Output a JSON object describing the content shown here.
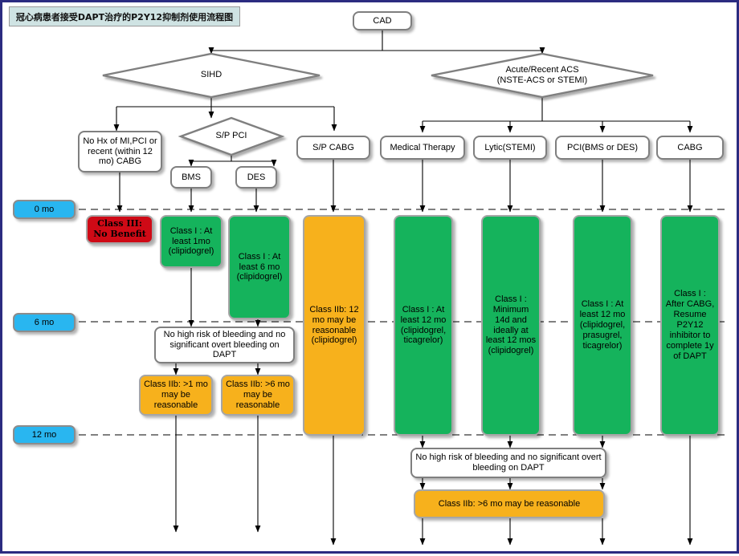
{
  "chart_title": "冠心病患者接受DAPT治疗的P2Y12抑制剂使用流程图",
  "colors": {
    "class1_green": "#15b35c",
    "class2b_orange": "#f7b11c",
    "class3_red": "#cf0a16",
    "timeline_blue": "#29b6f0",
    "title_bg": "#cfe3e3",
    "border_navy": "#2b2b80",
    "node_gray": "#7f7f7f"
  },
  "root": {
    "label": "CAD"
  },
  "decisions": {
    "sihd": "SIHD",
    "acs_line1": "Acute/Recent  ACS",
    "acs_line2": "(NSTE-ACS or STEMI)",
    "spci": "S/P PCI"
  },
  "timeline": [
    {
      "label": "0 mo"
    },
    {
      "label": "6 mo"
    },
    {
      "label": "12 mo"
    }
  ],
  "branches": {
    "no_hx": "No Hx of MI,PCI or recent (within 12 mo) CABG",
    "bms": "BMS",
    "des": "DES",
    "sp_cabg": "S/P CABG",
    "medical_therapy": "Medical Therapy",
    "lytic": "Lytic(STEMI)",
    "pci": "PCI(BMS or DES)",
    "cabg": "CABG"
  },
  "recommendations": {
    "no_hx_rec": "Class III: No Benefit",
    "bms_rec": "Class I : At least 1mo (clipidogrel)",
    "des_rec": "Class I : At least 6 mo (clipidogrel)",
    "cabg_sihd_rec": "Class IIb: 12 mo may be reasonable (clipidogrel)",
    "medical_rec": "Class I : At least 12 mo (clipidogrel, ticagrelor)",
    "lytic_rec": "Class I : Minimum 14d and ideally at least 12 mos (clipidogrel)",
    "pci_rec": "Class I : At least 12 mo (clipidogrel, prasugrel, ticagrelor)",
    "cabg_acs_rec": "Class I : After CABG, Resume P2Y12 inhibitor to complete 1y of DAPT"
  },
  "bleeding_gates": {
    "left": "No high risk of bleeding and no significant overt bleeding on DAPT",
    "right": "No high risk of bleeding and no significant overt bleeding on DAPT"
  },
  "extensions": {
    "bms_ext": "Class IIb: >1 mo may be reasonable",
    "des_ext": "Class IIb: >6 mo may be reasonable",
    "acs_ext": "Class IIb: >6 mo may be reasonable"
  }
}
